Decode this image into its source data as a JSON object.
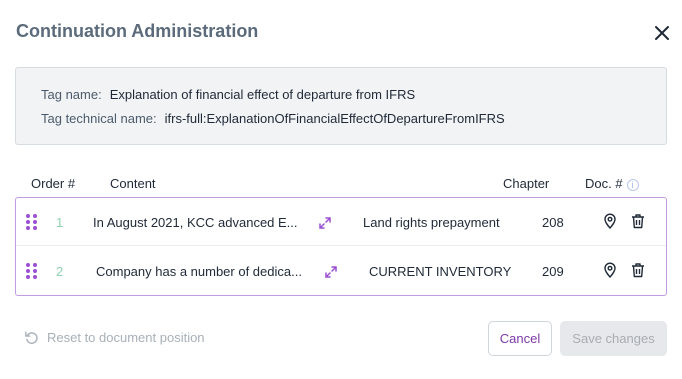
{
  "dialog": {
    "title": "Continuation Administration"
  },
  "tag_info": {
    "name_label": "Tag name:",
    "name_value": "Explanation of financial effect of departure from IFRS",
    "technical_label": "Tag technical name:",
    "technical_value": "ifrs-full:ExplanationOfFinancialEffectOfDepartureFromIFRS"
  },
  "table": {
    "headers": {
      "order": "Order #",
      "content": "Content",
      "chapter": "Chapter",
      "doc": "Doc. #"
    },
    "rows": [
      {
        "order": "1",
        "content": "In August 2021, KCC advanced E...",
        "chapter": "Land rights prepayment",
        "doc": "208"
      },
      {
        "order": "2",
        "content": "Company has a number of dedica...",
        "chapter": "CURRENT INVENTORY",
        "doc": "209"
      }
    ]
  },
  "footer": {
    "reset_label": "Reset to document position",
    "cancel_label": "Cancel",
    "save_label": "Save changes"
  },
  "colors": {
    "accent": "#7d3aa9",
    "handle": "#9b4fd1",
    "table_border": "#c39be3",
    "order_number": "#8fd3b0",
    "info_bg": "#f1f3f5"
  },
  "icons": {
    "close": "close-icon",
    "info": "info-icon",
    "drag": "drag-handle-icon",
    "expand": "expand-icon",
    "locate": "location-pin-icon",
    "delete": "trash-icon",
    "reset": "undo-icon"
  }
}
